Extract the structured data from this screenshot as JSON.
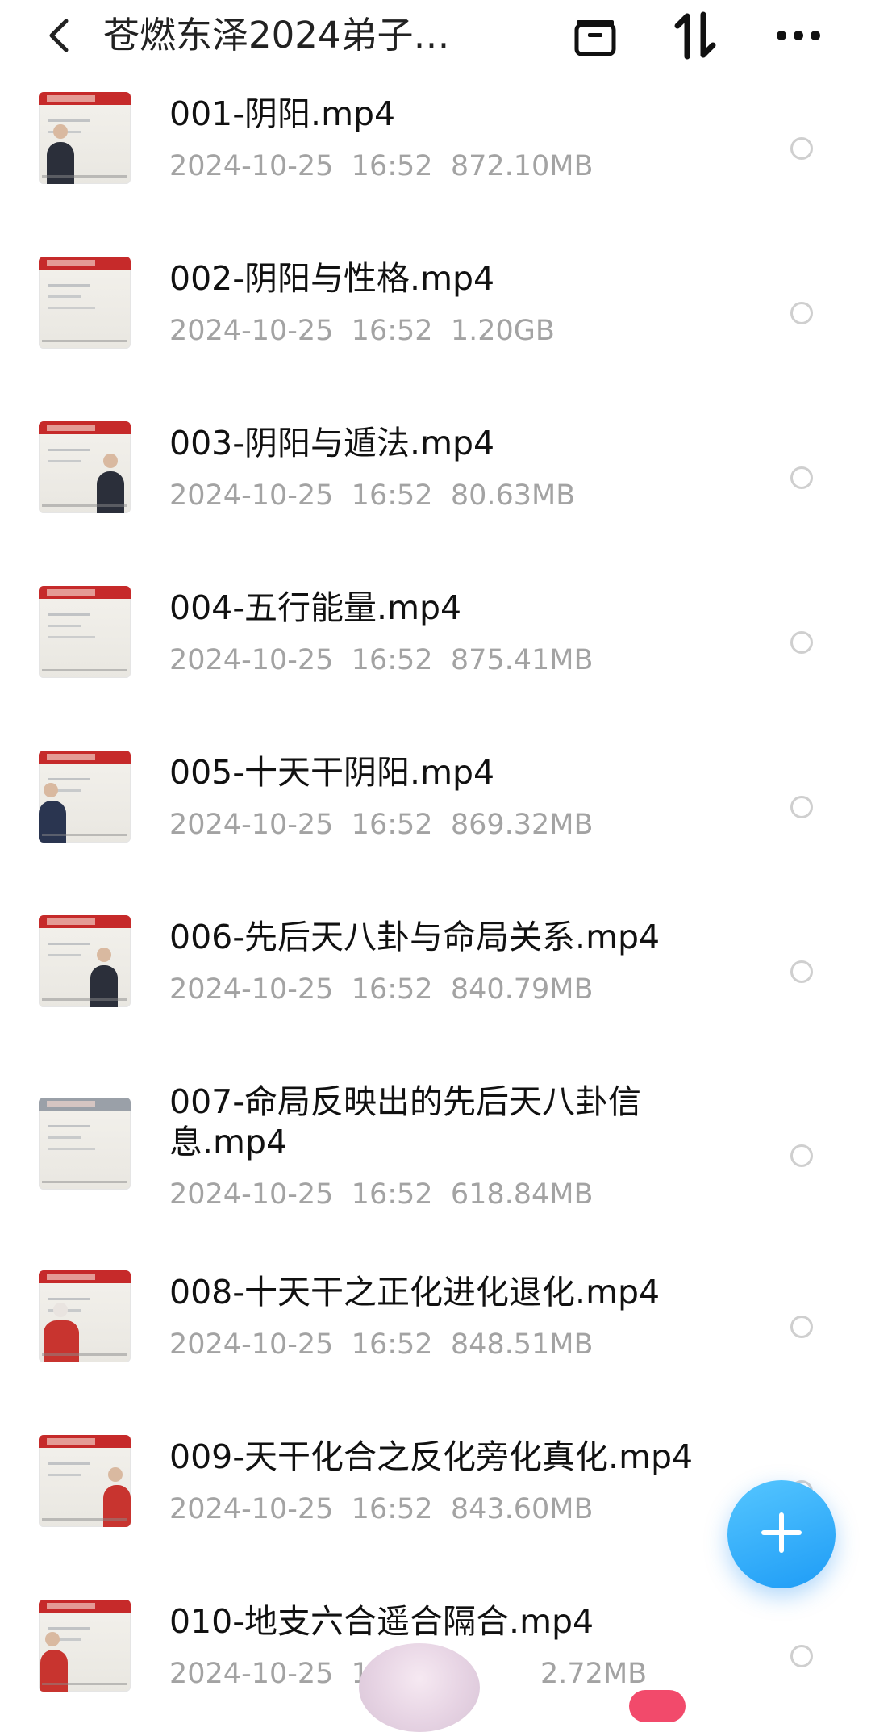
{
  "header": {
    "title": "苍燃东泽2024弟子…",
    "icons": [
      "back-icon",
      "folder-icon",
      "sort-icon",
      "more-icon"
    ]
  },
  "files": [
    {
      "name": "001-阴阳.mp4",
      "date": "2024-10-25",
      "time": "16:52",
      "size": "872.10MB"
    },
    {
      "name": "002-阴阳与性格.mp4",
      "date": "2024-10-25",
      "time": "16:52",
      "size": "1.20GB"
    },
    {
      "name": "003-阴阳与遁法.mp4",
      "date": "2024-10-25",
      "time": "16:52",
      "size": "80.63MB"
    },
    {
      "name": "004-五行能量.mp4",
      "date": "2024-10-25",
      "time": "16:52",
      "size": "875.41MB"
    },
    {
      "name": "005-十天干阴阳.mp4",
      "date": "2024-10-25",
      "time": "16:52",
      "size": "869.32MB"
    },
    {
      "name": "006-先后天八卦与命局关系.mp4",
      "date": "2024-10-25",
      "time": "16:52",
      "size": "840.79MB"
    },
    {
      "name": "007-命局反映出的先后天八卦信息.mp4",
      "date": "2024-10-25",
      "time": "16:52",
      "size": "618.84MB"
    },
    {
      "name": "008-十天干之正化进化退化.mp4",
      "date": "2024-10-25",
      "time": "16:52",
      "size": "848.51MB"
    },
    {
      "name": "009-天干化合之反化旁化真化.mp4",
      "date": "2024-10-25",
      "time": "16:52",
      "size": "843.60MB"
    },
    {
      "name": "010-地支六合遥合隔合.mp4",
      "date": "2024-10-25",
      "time": "16:",
      "size": "2.72MB"
    }
  ],
  "fab": {
    "icon": "plus-icon"
  }
}
